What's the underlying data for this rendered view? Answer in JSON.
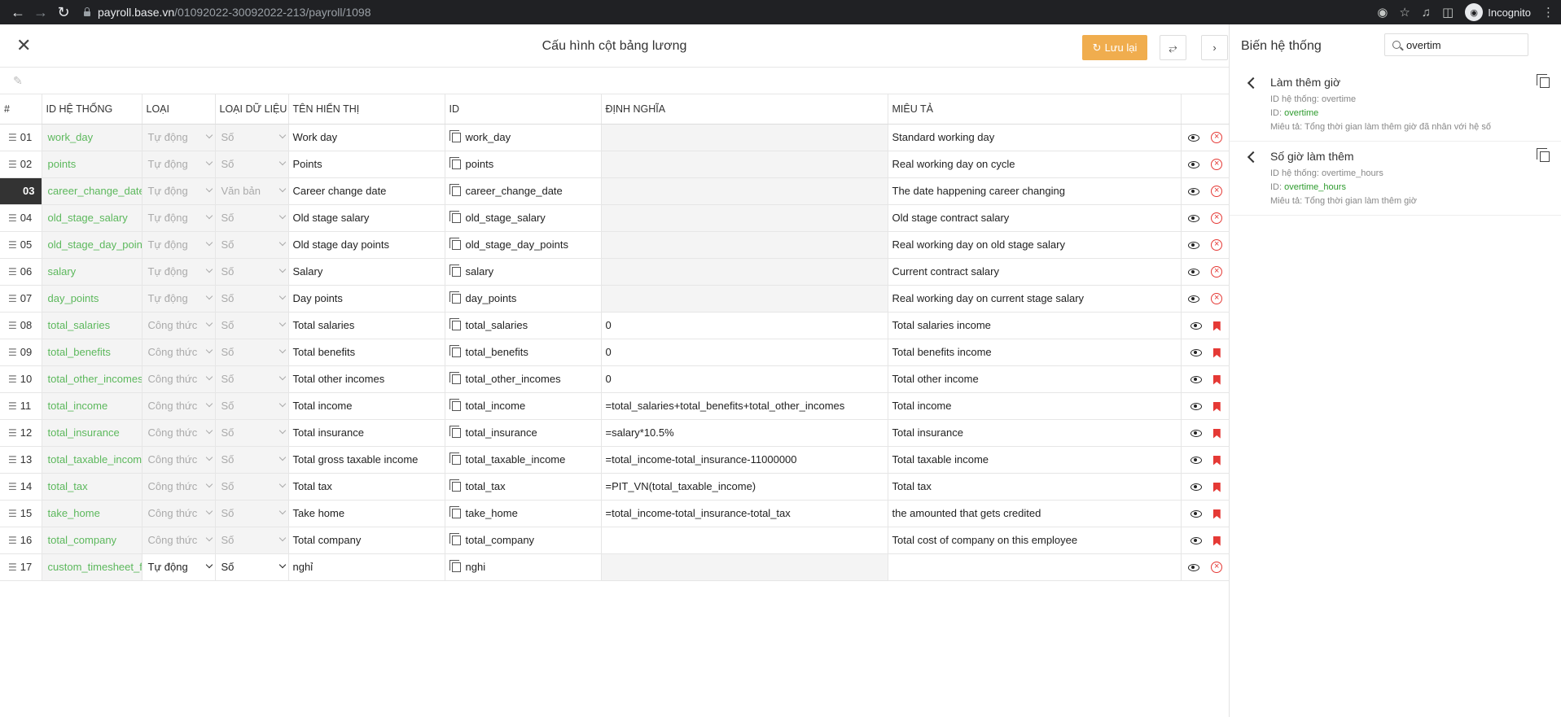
{
  "browser": {
    "url_host": "payroll.base.vn",
    "url_path": "/01092022-30092022-213/payroll/1098",
    "profile": "Incognito"
  },
  "header": {
    "title": "Cấu hình cột bảng lương",
    "save_label": "Lưu lại"
  },
  "columns": [
    "#",
    "ID HỆ THỐNG",
    "LOẠI",
    "LOẠI DỮ LIỆU",
    "TÊN HIỂN THỊ",
    "ID",
    "ĐỊNH NGHĨA",
    "MIÊU TẢ"
  ],
  "rows": [
    {
      "num": "01",
      "sys_id": "work_day",
      "type": "Tự động",
      "data_type": "Số",
      "name": "Work day",
      "id": "work_day",
      "definition": "",
      "desc": "Standard working day",
      "action": "remove"
    },
    {
      "num": "02",
      "sys_id": "points",
      "type": "Tự động",
      "data_type": "Số",
      "name": "Points",
      "id": "points",
      "definition": "",
      "desc": "Real working day on cycle",
      "action": "remove"
    },
    {
      "num": "03",
      "sys_id": "career_change_date_",
      "type": "Tự động",
      "data_type": "Văn bản",
      "name": "Career change date",
      "id": "career_change_date",
      "definition": "",
      "desc": "The date happening career changing",
      "action": "remove"
    },
    {
      "num": "04",
      "sys_id": "old_stage_salary",
      "type": "Tự động",
      "data_type": "Số",
      "name": "Old stage salary",
      "id": "old_stage_salary",
      "definition": "",
      "desc": "Old stage contract salary",
      "action": "remove"
    },
    {
      "num": "05",
      "sys_id": "old_stage_day_points",
      "type": "Tự động",
      "data_type": "Số",
      "name": "Old stage day points",
      "id": "old_stage_day_points",
      "definition": "",
      "desc": "Real working day on old stage salary",
      "action": "remove"
    },
    {
      "num": "06",
      "sys_id": "salary",
      "type": "Tự động",
      "data_type": "Số",
      "name": "Salary",
      "id": "salary",
      "definition": "",
      "desc": "Current contract salary",
      "action": "remove"
    },
    {
      "num": "07",
      "sys_id": "day_points",
      "type": "Tự động",
      "data_type": "Số",
      "name": "Day points",
      "id": "day_points",
      "definition": "",
      "desc": "Real working day on current stage salary",
      "action": "remove"
    },
    {
      "num": "08",
      "sys_id": "total_salaries",
      "type": "Công thức",
      "data_type": "Số",
      "name": "Total salaries",
      "id": "total_salaries",
      "definition": "0",
      "desc": "Total salaries income",
      "action": "bookmark"
    },
    {
      "num": "09",
      "sys_id": "total_benefits",
      "type": "Công thức",
      "data_type": "Số",
      "name": "Total benefits",
      "id": "total_benefits",
      "definition": "0",
      "desc": "Total benefits income",
      "action": "bookmark"
    },
    {
      "num": "10",
      "sys_id": "total_other_incomes",
      "type": "Công thức",
      "data_type": "Số",
      "name": "Total other incomes",
      "id": "total_other_incomes",
      "definition": "0",
      "desc": "Total other income",
      "action": "bookmark"
    },
    {
      "num": "11",
      "sys_id": "total_income",
      "type": "Công thức",
      "data_type": "Số",
      "name": "Total income",
      "id": "total_income",
      "definition": "=total_salaries+total_benefits+total_other_incomes",
      "desc": "Total income",
      "action": "bookmark"
    },
    {
      "num": "12",
      "sys_id": "total_insurance",
      "type": "Công thức",
      "data_type": "Số",
      "name": "Total insurance",
      "id": "total_insurance",
      "definition": "=salary*10.5%",
      "desc": "Total insurance",
      "action": "bookmark"
    },
    {
      "num": "13",
      "sys_id": "total_taxable_income",
      "type": "Công thức",
      "data_type": "Số",
      "name": "Total gross taxable income",
      "id": "total_taxable_income",
      "definition": "=total_income-total_insurance-11000000",
      "desc": "Total taxable income",
      "action": "bookmark"
    },
    {
      "num": "14",
      "sys_id": "total_tax",
      "type": "Công thức",
      "data_type": "Số",
      "name": "Total tax",
      "id": "total_tax",
      "definition": "=PIT_VN(total_taxable_income)",
      "desc": "Total tax",
      "action": "bookmark"
    },
    {
      "num": "15",
      "sys_id": "take_home",
      "type": "Công thức",
      "data_type": "Số",
      "name": "Take home",
      "id": "take_home",
      "definition": "=total_income-total_insurance-total_tax",
      "desc": "the amounted that gets credited",
      "action": "bookmark"
    },
    {
      "num": "16",
      "sys_id": "total_company",
      "type": "Công thức",
      "data_type": "Số",
      "name": "Total company",
      "id": "total_company",
      "definition": "",
      "desc": "Total cost of company on this employee",
      "action": "bookmark"
    },
    {
      "num": "17",
      "sys_id": "custom_timesheet_fi",
      "type": "Tự động",
      "data_type": "Số",
      "name": "nghỉ",
      "id": "nghi",
      "definition": "",
      "desc": "",
      "action": "remove"
    }
  ],
  "sidebar": {
    "title": "Biến hệ thống",
    "search_value": "overtim",
    "results": [
      {
        "title": "Làm thêm giờ",
        "sys_label": "ID hệ thống: ",
        "sys_id": "overtime",
        "id_label": "ID: ",
        "id": "overtime",
        "desc_label": "Miêu tả: ",
        "desc": "Tổng thời gian làm thêm giờ đã nhân với hệ số"
      },
      {
        "title": "Số giờ làm thêm",
        "sys_label": "ID hệ thống: ",
        "sys_id": "overtime_hours",
        "id_label": "ID: ",
        "id": "overtime_hours",
        "desc_label": "Miêu tả: ",
        "desc": "Tổng thời gian làm thêm giờ"
      }
    ]
  }
}
